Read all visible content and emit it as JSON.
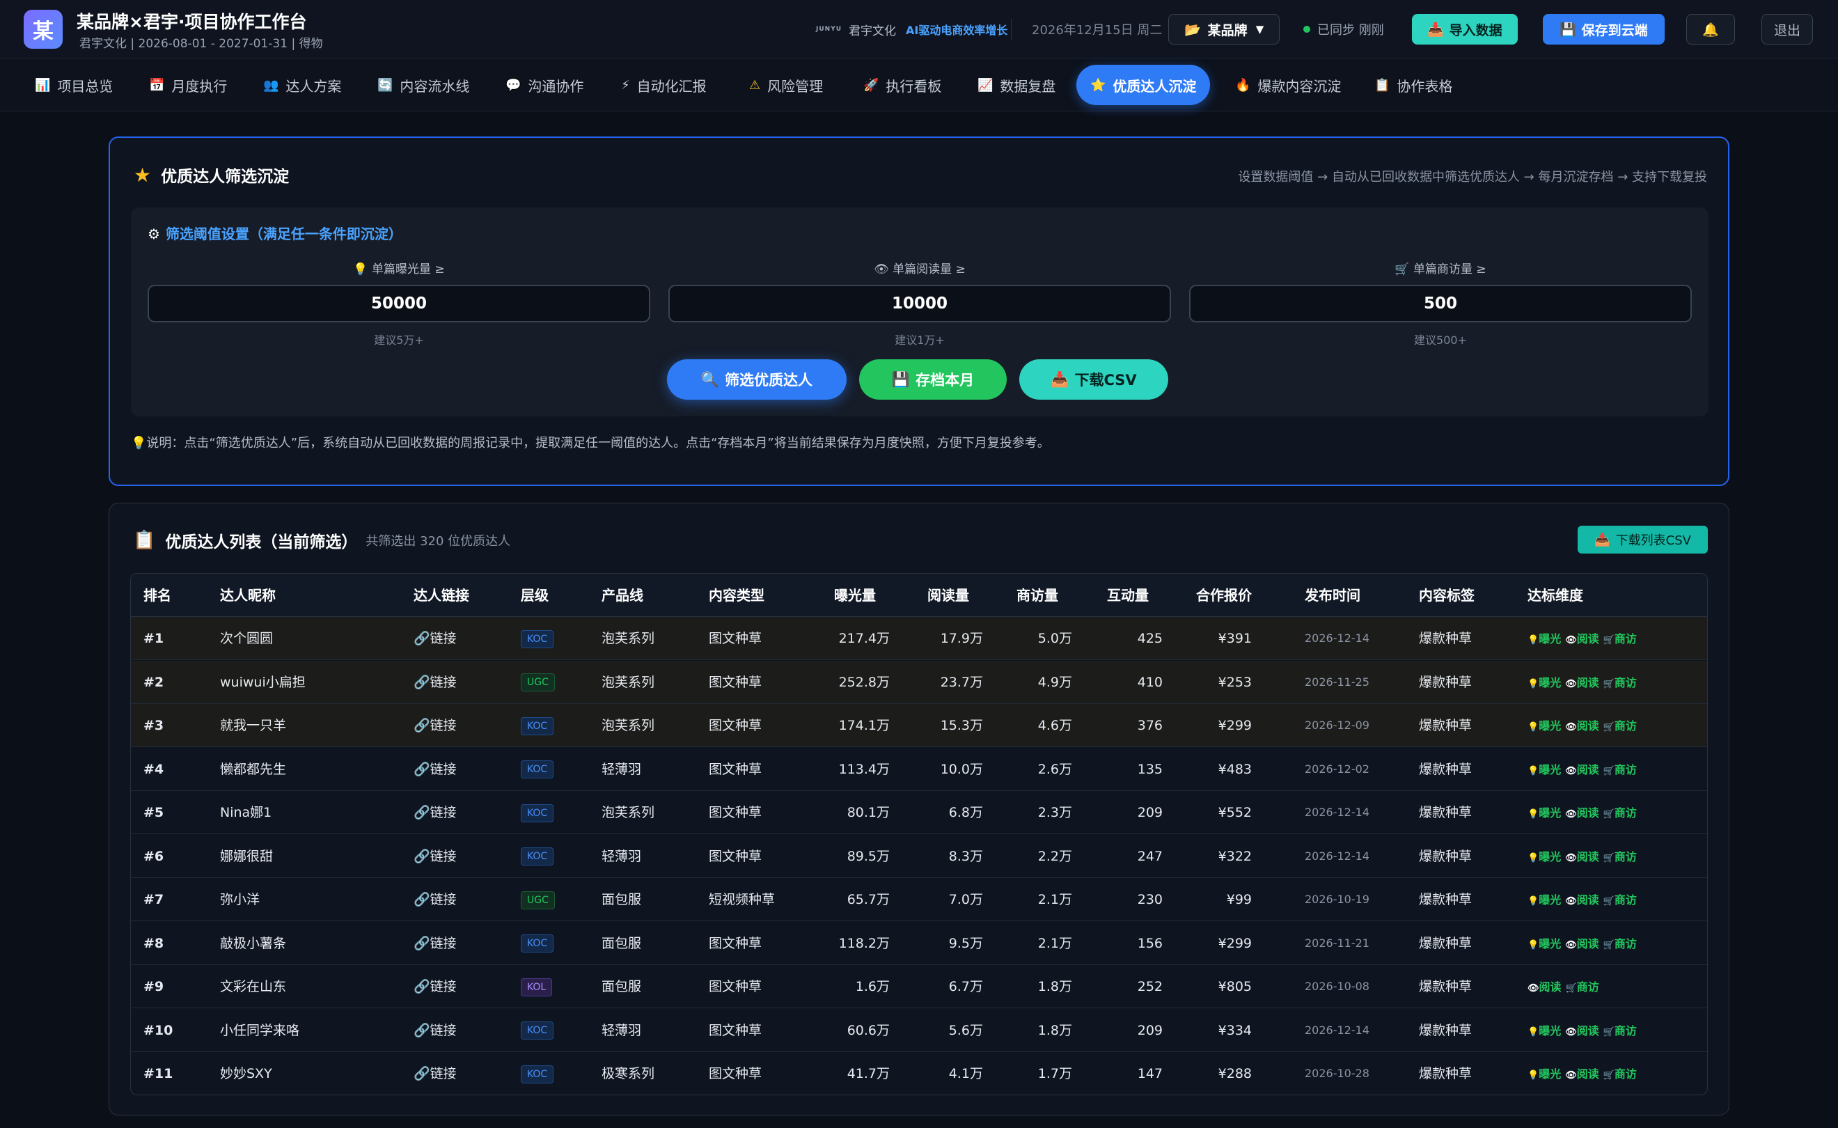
{
  "header": {
    "logo_char": "某",
    "title": "某品牌×君宇·项目协作工作台",
    "subtitle": "君宇文化 | 2026-08-01 - 2027-01-31 | 得物",
    "company": "君宇文化",
    "slogan": "AI驱动电商效率增长",
    "date": "2026年12月15日 周二",
    "brand_select": "某品牌",
    "sync_status": "已同步 刚刚",
    "import_label": "导入数据",
    "save_label": "保存到云端",
    "logout_label": "退出"
  },
  "tabs": [
    {
      "icon": "📊",
      "label": "项目总览"
    },
    {
      "icon": "📅",
      "label": "月度执行"
    },
    {
      "icon": "👥",
      "label": "达人方案"
    },
    {
      "icon": "🔄",
      "label": "内容流水线"
    },
    {
      "icon": "💬",
      "label": "沟通协作"
    },
    {
      "icon": "⚡",
      "label": "自动化汇报"
    },
    {
      "icon": "⚠",
      "label": "风险管理"
    },
    {
      "icon": "🚀",
      "label": "执行看板"
    },
    {
      "icon": "📈",
      "label": "数据复盘"
    },
    {
      "icon": "⭐",
      "label": "优质达人沉淀"
    },
    {
      "icon": "🔥",
      "label": "爆款内容沉淀"
    },
    {
      "icon": "📋",
      "label": "协作表格"
    }
  ],
  "filter": {
    "title": "优质达人筛选沉淀",
    "hint": "设置数据阈值 → 自动从已回收数据中筛选优质达人 → 每月沉淀存档 → 支持下载复投",
    "threshold_title": "筛选阈值设置（满足任一条件即沉淀）",
    "fields": [
      {
        "label": "单篇曝光量 ≥",
        "value": "50000",
        "hint": "建议5万+"
      },
      {
        "label": "单篇阅读量 ≥",
        "value": "10000",
        "hint": "建议1万+"
      },
      {
        "label": "单篇商访量 ≥",
        "value": "500",
        "hint": "建议500+"
      }
    ],
    "btn_filter": "筛选优质达人",
    "btn_archive": "存档本月",
    "btn_download": "下载CSV",
    "note": "说明：点击“筛选优质达人”后，系统自动从已回收数据的周报记录中，提取满足任一阈值的达人。点击“存档本月”将当前结果保存为月度快照，方便下月复投参考。"
  },
  "list": {
    "title": "优质达人列表（当前筛选）",
    "count": "共筛选出 320 位优质达人",
    "download_label": "下载列表CSV",
    "columns": [
      "排名",
      "达人昵称",
      "达人链接",
      "层级",
      "产品线",
      "内容类型",
      "曝光量",
      "阅读量",
      "商访量",
      "互动量",
      "合作报价",
      "发布时间",
      "内容标签",
      "达标维度"
    ],
    "link_text": "链接",
    "dim_labels": {
      "exposure": "曝光",
      "read": "阅读",
      "visit": "商访"
    },
    "rows": [
      {
        "rank": "#1",
        "name": "次个圆圆",
        "tier": "KOC",
        "line": "泡芙系列",
        "type": "图文种草",
        "exposure": "217.4万",
        "read": "17.9万",
        "visit": "5.0万",
        "interact": "425",
        "price": "¥391",
        "date": "2026-12-14",
        "tag": "爆款种草",
        "dims": [
          "曝光",
          "阅读",
          "商访"
        ]
      },
      {
        "rank": "#2",
        "name": "wuiwui小扁担",
        "tier": "UGC",
        "line": "泡芙系列",
        "type": "图文种草",
        "exposure": "252.8万",
        "read": "23.7万",
        "visit": "4.9万",
        "interact": "410",
        "price": "¥253",
        "date": "2026-11-25",
        "tag": "爆款种草",
        "dims": [
          "曝光",
          "阅读",
          "商访"
        ]
      },
      {
        "rank": "#3",
        "name": "就我一只羊",
        "tier": "KOC",
        "line": "泡芙系列",
        "type": "图文种草",
        "exposure": "174.1万",
        "read": "15.3万",
        "visit": "4.6万",
        "interact": "376",
        "price": "¥299",
        "date": "2026-12-09",
        "tag": "爆款种草",
        "dims": [
          "曝光",
          "阅读",
          "商访"
        ]
      },
      {
        "rank": "#4",
        "name": "懒都都先生",
        "tier": "KOC",
        "line": "轻薄羽",
        "type": "图文种草",
        "exposure": "113.4万",
        "read": "10.0万",
        "visit": "2.6万",
        "interact": "135",
        "price": "¥483",
        "date": "2026-12-02",
        "tag": "爆款种草",
        "dims": [
          "曝光",
          "阅读",
          "商访"
        ]
      },
      {
        "rank": "#5",
        "name": "Nina娜1",
        "tier": "KOC",
        "line": "泡芙系列",
        "type": "图文种草",
        "exposure": "80.1万",
        "read": "6.8万",
        "visit": "2.3万",
        "interact": "209",
        "price": "¥552",
        "date": "2026-12-14",
        "tag": "爆款种草",
        "dims": [
          "曝光",
          "阅读",
          "商访"
        ]
      },
      {
        "rank": "#6",
        "name": "娜娜很甜",
        "tier": "KOC",
        "line": "轻薄羽",
        "type": "图文种草",
        "exposure": "89.5万",
        "read": "8.3万",
        "visit": "2.2万",
        "interact": "247",
        "price": "¥322",
        "date": "2026-12-14",
        "tag": "爆款种草",
        "dims": [
          "曝光",
          "阅读",
          "商访"
        ]
      },
      {
        "rank": "#7",
        "name": "弥小洋",
        "tier": "UGC",
        "line": "面包服",
        "type": "短视频种草",
        "exposure": "65.7万",
        "read": "7.0万",
        "visit": "2.1万",
        "interact": "230",
        "price": "¥99",
        "date": "2026-10-19",
        "tag": "爆款种草",
        "dims": [
          "曝光",
          "阅读",
          "商访"
        ]
      },
      {
        "rank": "#8",
        "name": "敲极小薯条",
        "tier": "KOC",
        "line": "面包服",
        "type": "图文种草",
        "exposure": "118.2万",
        "read": "9.5万",
        "visit": "2.1万",
        "interact": "156",
        "price": "¥299",
        "date": "2026-11-21",
        "tag": "爆款种草",
        "dims": [
          "曝光",
          "阅读",
          "商访"
        ]
      },
      {
        "rank": "#9",
        "name": "文彩在山东",
        "tier": "KOL",
        "line": "面包服",
        "type": "图文种草",
        "exposure": "1.6万",
        "read": "6.7万",
        "visit": "1.8万",
        "interact": "252",
        "price": "¥805",
        "date": "2026-10-08",
        "tag": "爆款种草",
        "dims": [
          "阅读",
          "商访"
        ]
      },
      {
        "rank": "#10",
        "name": "小任同学来咯",
        "tier": "KOC",
        "line": "轻薄羽",
        "type": "图文种草",
        "exposure": "60.6万",
        "read": "5.6万",
        "visit": "1.8万",
        "interact": "209",
        "price": "¥334",
        "date": "2026-12-14",
        "tag": "爆款种草",
        "dims": [
          "曝光",
          "阅读",
          "商访"
        ]
      },
      {
        "rank": "#11",
        "name": "妙妙SXY",
        "tier": "KOC",
        "line": "极寒系列",
        "type": "图文种草",
        "exposure": "41.7万",
        "read": "4.1万",
        "visit": "1.7万",
        "interact": "147",
        "price": "¥288",
        "date": "2026-10-28",
        "tag": "爆款种草",
        "dims": [
          "曝光",
          "阅读",
          "商访"
        ]
      }
    ]
  },
  "colors": {
    "accent": "#2f7bf5",
    "teal": "#2dd4bf",
    "green": "#22c55e",
    "background": "#0b0f17"
  }
}
